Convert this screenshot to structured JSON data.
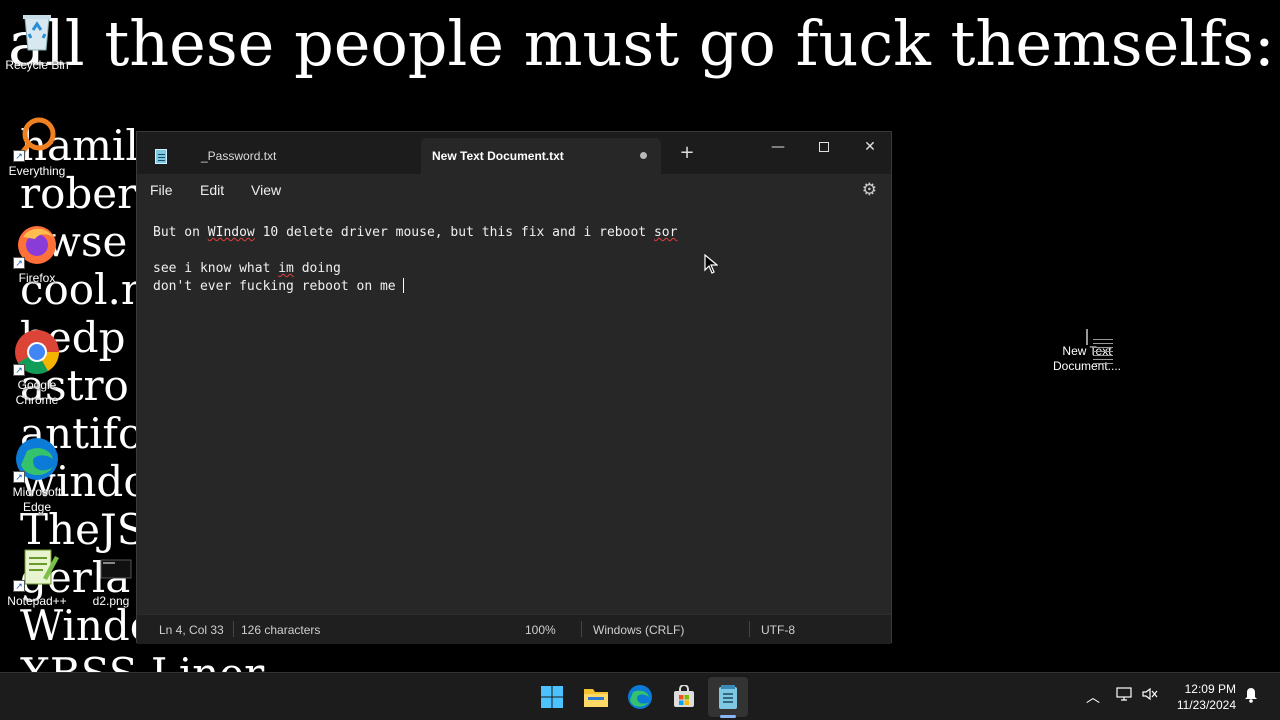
{
  "wallpaper": {
    "title": "all these people must go fuck themselfs:",
    "names": [
      "hamil",
      "rober",
      "awse",
      "cool.n",
      "bedp",
      "astro",
      "antifo",
      "windo",
      "TheJS",
      "gerla",
      "Windo",
      "XBSS Liner"
    ]
  },
  "desktop_icons": {
    "recycle_bin": "Recycle Bin",
    "everything": "Everything",
    "firefox": "Firefox",
    "chrome": "Google Chrome",
    "edge": "Microsoft Edge",
    "notepadpp": "Notepad++",
    "d2": "d2.png",
    "new_text_doc": "New Text Document...."
  },
  "notepad": {
    "tabs": [
      {
        "label": "_Password.txt",
        "active": false
      },
      {
        "label": "New Text Document.txt",
        "active": true,
        "unsaved": true
      }
    ],
    "new_tab": "+",
    "menu": {
      "file": "File",
      "edit": "Edit",
      "view": "View"
    },
    "content": {
      "line1_a": "But on ",
      "line1_b": "WIndow",
      "line1_c": " 10 delete driver mouse, but this fix and i reboot ",
      "line1_d": "sor",
      "line3_a": "see i know what ",
      "line3_b": "im",
      "line3_c": " doing",
      "line4": "don't ever fucking reboot on me "
    },
    "status": {
      "position": "Ln 4, Col 33",
      "chars": "126 characters",
      "zoom": "100%",
      "line_endings": "Windows (CRLF)",
      "encoding": "UTF-8"
    }
  },
  "taskbar": {
    "time": "12:09 PM",
    "date": "11/23/2024",
    "apps": [
      "start-icon",
      "file-explorer-icon",
      "edge-icon",
      "store-icon",
      "notepad-icon"
    ]
  },
  "colors": {
    "window_bg": "#272727",
    "tabbar_bg": "#1c1c1c",
    "taskbar_bg": "#1c1c1c",
    "accent": "#8ab4f8"
  }
}
